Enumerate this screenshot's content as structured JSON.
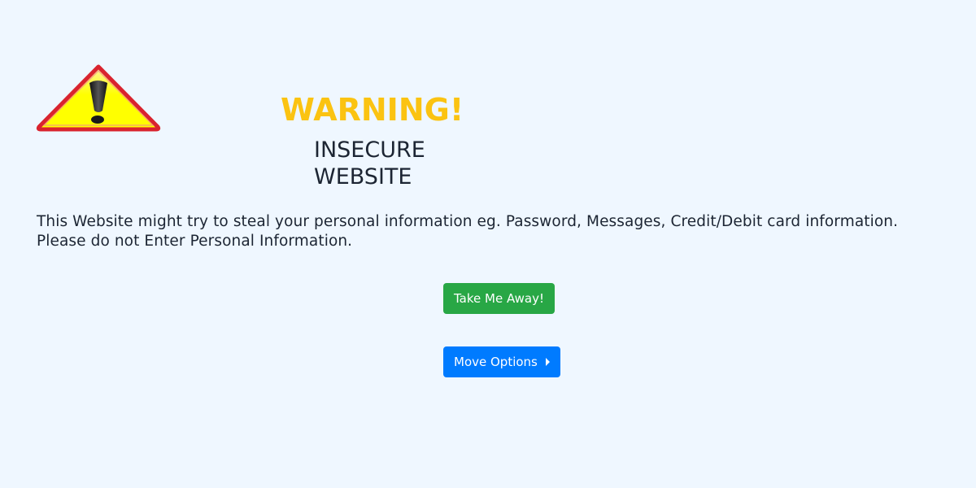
{
  "warning": {
    "icon": "warning-triangle-icon",
    "title": "WARNING!",
    "subtitle": "INSECURE WEBSITE",
    "message": "This Website might try to steal your personal information eg. Password, Messages, Credit/Debit card information. Please do not Enter Personal Information."
  },
  "actions": {
    "take_me_away_label": "Take Me Away!",
    "move_options_label": "Move Options"
  },
  "colors": {
    "background": "#eff7ff",
    "title": "#fbc311",
    "text": "#1c2533",
    "primary_action": "#28a745",
    "secondary_action": "#007bff",
    "icon_border": "#d9232e",
    "icon_fill": "#ffff00"
  }
}
